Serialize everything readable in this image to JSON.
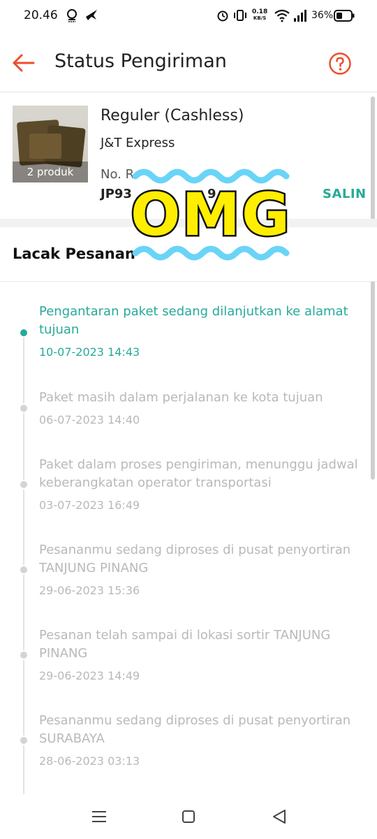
{
  "status_bar": {
    "time": "20.46",
    "net_speed_value": "0.18",
    "net_speed_unit": "KB/S",
    "battery": "36%",
    "icons": [
      "notification-icon",
      "bird-icon",
      "alarm-icon",
      "vibrate-icon",
      "wifi-icon",
      "signal-icon",
      "battery-icon"
    ]
  },
  "header": {
    "title": "Status Pengiriman",
    "back_icon": "arrow-left-icon",
    "help_icon": "help-circle-icon",
    "accent_color": "#ee4d2d"
  },
  "package": {
    "product_count": "2 produk",
    "service": "Reguler (Cashless)",
    "courier": "J&T Express",
    "resi_label": "No. R",
    "resi_number": "JP93",
    "resi_number_tail": "9",
    "copy_label": "SALIN"
  },
  "sticker": {
    "text": "OMG",
    "fill_color": "#ffee00",
    "wave_color": "#6ad4f7"
  },
  "tracking": {
    "title": "Lacak Pesanan",
    "accent_color": "#26aa99",
    "events": [
      {
        "text": "Pengantaran paket sedang dilanjutkan ke alamat tujuan",
        "time": "10-07-2023 14:43"
      },
      {
        "text": "Paket masih dalam perjalanan ke kota tujuan",
        "time": "06-07-2023 14:40"
      },
      {
        "text": "Paket dalam proses pengiriman, menunggu jadwal keberangkatan operator transportasi",
        "time": "03-07-2023 16:49"
      },
      {
        "text": "Pesananmu sedang diproses di pusat penyortiran TANJUNG PINANG",
        "time": "29-06-2023 15:36"
      },
      {
        "text": "Pesanan telah sampai di lokasi sortir TANJUNG PINANG",
        "time": "29-06-2023 14:49"
      },
      {
        "text": "Pesananmu sedang diproses di pusat penyortiran SURABAYA",
        "time": "28-06-2023 03:13"
      }
    ]
  },
  "nav_bar": {
    "icons": [
      "menu-icon",
      "home-square-icon",
      "back-triangle-icon"
    ]
  }
}
